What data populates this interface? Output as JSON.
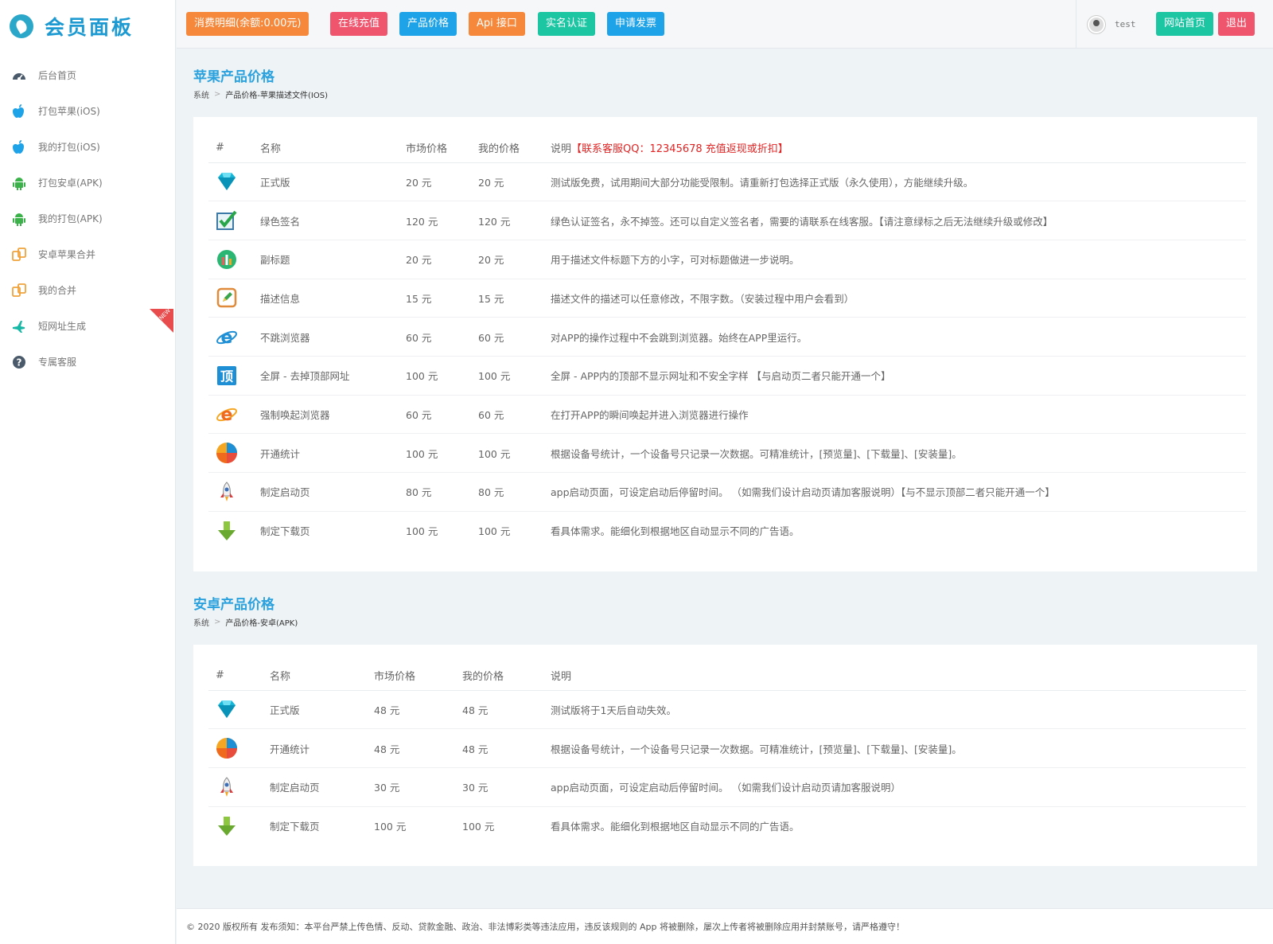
{
  "logo": {
    "text": "会员面板"
  },
  "sidebar": {
    "items": [
      {
        "label": "后台首页",
        "icon": "dashboard-icon",
        "color": "#4a5a6a"
      },
      {
        "label": "打包苹果(iOS)",
        "icon": "apple-icon",
        "color": "#1fa3e8"
      },
      {
        "label": "我的打包(iOS)",
        "icon": "apple-icon",
        "color": "#1fa3e8"
      },
      {
        "label": "打包安卓(APK)",
        "icon": "android-icon",
        "color": "#3bb34a"
      },
      {
        "label": "我的打包(APK)",
        "icon": "android-icon",
        "color": "#3bb34a"
      },
      {
        "label": "安卓苹果合并",
        "icon": "merge-icon",
        "color": "#f0a23b"
      },
      {
        "label": "我的合并",
        "icon": "merge-icon",
        "color": "#f0a23b"
      },
      {
        "label": "短网址生成",
        "icon": "plane-icon",
        "color": "#17b8a6",
        "badge": "NEW"
      },
      {
        "label": "专属客服",
        "icon": "help-icon",
        "color": "#4a5a6a"
      }
    ]
  },
  "topbar": {
    "buttons": [
      {
        "label": "消费明细(余额:0.00元)",
        "color": "#f5883b"
      },
      {
        "label": "在线充值",
        "color": "#f0556e"
      },
      {
        "label": "产品价格",
        "color": "#1fa3e8"
      },
      {
        "label": "Api 接口",
        "color": "#f5883b"
      },
      {
        "label": "实名认证",
        "color": "#1dc6a3"
      },
      {
        "label": "申请发票",
        "color": "#1fa3e8"
      }
    ],
    "username": "test",
    "site_home": "网站首页",
    "logout": "退出",
    "site_home_color": "#1dc6a3",
    "logout_color": "#f0556e"
  },
  "ios": {
    "title": "苹果产品价格",
    "crumb_root": "系统",
    "crumb_current": "产品价格-苹果描述文件(IOS)",
    "headers": {
      "num": "#",
      "name": "名称",
      "market": "市场价格",
      "mine": "我的价格",
      "desc": "说明",
      "desc_note": "【联系客服QQ：12345678 充值返现或折扣】"
    },
    "rows": [
      {
        "icon": "diamond-icon",
        "name": "正式版",
        "market": "20 元",
        "mine": "20 元",
        "desc": "测试版免费，试用期间大部分功能受限制。请重新打包选择正式版（永久使用），方能继续升级。"
      },
      {
        "icon": "checkmark-icon",
        "name": "绿色签名",
        "market": "120 元",
        "mine": "120 元",
        "desc": "绿色认证签名，永不掉签。还可以自定义签名者，需要的请联系在线客服。【请注意绿标之后无法继续升级或修改】"
      },
      {
        "icon": "subtitle-icon",
        "name": "副标题",
        "market": "20 元",
        "mine": "20 元",
        "desc": "用于描述文件标题下方的小字，可对标题做进一步说明。"
      },
      {
        "icon": "edit-icon",
        "name": "描述信息",
        "market": "15 元",
        "mine": "15 元",
        "desc": "描述文件的描述可以任意修改，不限字数。（安装过程中用户会看到）"
      },
      {
        "icon": "ie-browser-icon",
        "name": "不跳浏览器",
        "market": "60 元",
        "mine": "60 元",
        "desc": "对APP的操作过程中不会跳到浏览器。始终在APP里运行。"
      },
      {
        "icon": "top-icon",
        "name": "全屏 - 去掉顶部网址",
        "market": "100 元",
        "mine": "100 元",
        "desc": "全屏 - APP内的顶部不显示网址和不安全字样 【与启动页二者只能开通一个】"
      },
      {
        "icon": "browser-launch-icon",
        "name": "强制唤起浏览器",
        "market": "60 元",
        "mine": "60 元",
        "desc": "在打开APP的瞬间唤起并进入浏览器进行操作"
      },
      {
        "icon": "stats-icon",
        "name": "开通统计",
        "market": "100 元",
        "mine": "100 元",
        "desc": "根据设备号统计，一个设备号只记录一次数据。可精准统计，[预览量]、[下载量]、[安装量]。"
      },
      {
        "icon": "rocket-icon",
        "name": "制定启动页",
        "market": "80 元",
        "mine": "80 元",
        "desc": "app启动页面，可设定启动后停留时间。 （如需我们设计启动页请加客服说明）【与不显示顶部二者只能开通一个】"
      },
      {
        "icon": "download-arrow-icon",
        "name": "制定下载页",
        "market": "100 元",
        "mine": "100 元",
        "desc": "看具体需求。能细化到根据地区自动显示不同的广告语。"
      }
    ]
  },
  "android": {
    "title": "安卓产品价格",
    "crumb_root": "系统",
    "crumb_current": "产品价格-安卓(APK)",
    "headers": {
      "num": "#",
      "name": "名称",
      "market": "市场价格",
      "mine": "我的价格",
      "desc": "说明"
    },
    "rows": [
      {
        "icon": "diamond-icon",
        "name": "正式版",
        "market": "48 元",
        "mine": "48 元",
        "desc": "测试版将于1天后自动失效。"
      },
      {
        "icon": "stats-icon",
        "name": "开通统计",
        "market": "48 元",
        "mine": "48 元",
        "desc": "根据设备号统计，一个设备号只记录一次数据。可精准统计，[预览量]、[下载量]、[安装量]。"
      },
      {
        "icon": "rocket-icon",
        "name": "制定启动页",
        "market": "30 元",
        "mine": "30 元",
        "desc": "app启动页面，可设定启动后停留时间。 （如需我们设计启动页请加客服说明）"
      },
      {
        "icon": "download-arrow-icon",
        "name": "制定下载页",
        "market": "100 元",
        "mine": "100 元",
        "desc": "看具体需求。能细化到根据地区自动显示不同的广告语。"
      }
    ]
  },
  "footer": {
    "text": "© 2020 版权所有 发布须知：本平台严禁上传色情、反动、贷款金融、政治、非法博彩类等违法应用，违反该规则的 App 将被删除，屡次上传者将被删除应用并封禁账号，请严格遵守！"
  }
}
